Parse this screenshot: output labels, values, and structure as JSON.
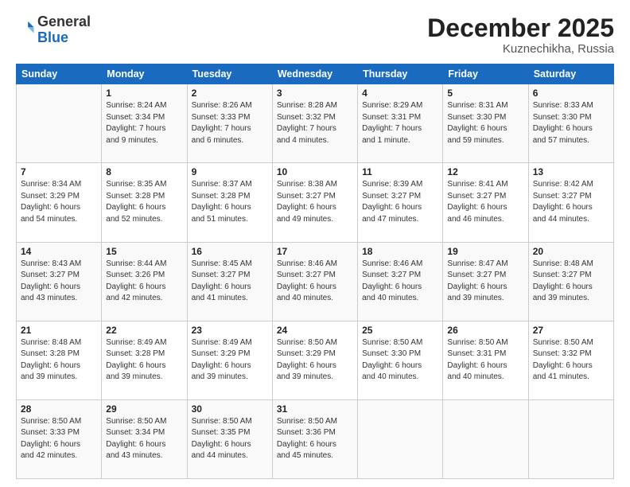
{
  "header": {
    "logo_line1": "General",
    "logo_line2": "Blue",
    "month": "December 2025",
    "location": "Kuznechikha, Russia"
  },
  "days_of_week": [
    "Sunday",
    "Monday",
    "Tuesday",
    "Wednesday",
    "Thursday",
    "Friday",
    "Saturday"
  ],
  "weeks": [
    [
      {
        "day": "",
        "info": ""
      },
      {
        "day": "1",
        "info": "Sunrise: 8:24 AM\nSunset: 3:34 PM\nDaylight: 7 hours\nand 9 minutes."
      },
      {
        "day": "2",
        "info": "Sunrise: 8:26 AM\nSunset: 3:33 PM\nDaylight: 7 hours\nand 6 minutes."
      },
      {
        "day": "3",
        "info": "Sunrise: 8:28 AM\nSunset: 3:32 PM\nDaylight: 7 hours\nand 4 minutes."
      },
      {
        "day": "4",
        "info": "Sunrise: 8:29 AM\nSunset: 3:31 PM\nDaylight: 7 hours\nand 1 minute."
      },
      {
        "day": "5",
        "info": "Sunrise: 8:31 AM\nSunset: 3:30 PM\nDaylight: 6 hours\nand 59 minutes."
      },
      {
        "day": "6",
        "info": "Sunrise: 8:33 AM\nSunset: 3:30 PM\nDaylight: 6 hours\nand 57 minutes."
      }
    ],
    [
      {
        "day": "7",
        "info": "Sunrise: 8:34 AM\nSunset: 3:29 PM\nDaylight: 6 hours\nand 54 minutes."
      },
      {
        "day": "8",
        "info": "Sunrise: 8:35 AM\nSunset: 3:28 PM\nDaylight: 6 hours\nand 52 minutes."
      },
      {
        "day": "9",
        "info": "Sunrise: 8:37 AM\nSunset: 3:28 PM\nDaylight: 6 hours\nand 51 minutes."
      },
      {
        "day": "10",
        "info": "Sunrise: 8:38 AM\nSunset: 3:27 PM\nDaylight: 6 hours\nand 49 minutes."
      },
      {
        "day": "11",
        "info": "Sunrise: 8:39 AM\nSunset: 3:27 PM\nDaylight: 6 hours\nand 47 minutes."
      },
      {
        "day": "12",
        "info": "Sunrise: 8:41 AM\nSunset: 3:27 PM\nDaylight: 6 hours\nand 46 minutes."
      },
      {
        "day": "13",
        "info": "Sunrise: 8:42 AM\nSunset: 3:27 PM\nDaylight: 6 hours\nand 44 minutes."
      }
    ],
    [
      {
        "day": "14",
        "info": "Sunrise: 8:43 AM\nSunset: 3:27 PM\nDaylight: 6 hours\nand 43 minutes."
      },
      {
        "day": "15",
        "info": "Sunrise: 8:44 AM\nSunset: 3:26 PM\nDaylight: 6 hours\nand 42 minutes."
      },
      {
        "day": "16",
        "info": "Sunrise: 8:45 AM\nSunset: 3:27 PM\nDaylight: 6 hours\nand 41 minutes."
      },
      {
        "day": "17",
        "info": "Sunrise: 8:46 AM\nSunset: 3:27 PM\nDaylight: 6 hours\nand 40 minutes."
      },
      {
        "day": "18",
        "info": "Sunrise: 8:46 AM\nSunset: 3:27 PM\nDaylight: 6 hours\nand 40 minutes."
      },
      {
        "day": "19",
        "info": "Sunrise: 8:47 AM\nSunset: 3:27 PM\nDaylight: 6 hours\nand 39 minutes."
      },
      {
        "day": "20",
        "info": "Sunrise: 8:48 AM\nSunset: 3:27 PM\nDaylight: 6 hours\nand 39 minutes."
      }
    ],
    [
      {
        "day": "21",
        "info": "Sunrise: 8:48 AM\nSunset: 3:28 PM\nDaylight: 6 hours\nand 39 minutes."
      },
      {
        "day": "22",
        "info": "Sunrise: 8:49 AM\nSunset: 3:28 PM\nDaylight: 6 hours\nand 39 minutes."
      },
      {
        "day": "23",
        "info": "Sunrise: 8:49 AM\nSunset: 3:29 PM\nDaylight: 6 hours\nand 39 minutes."
      },
      {
        "day": "24",
        "info": "Sunrise: 8:50 AM\nSunset: 3:29 PM\nDaylight: 6 hours\nand 39 minutes."
      },
      {
        "day": "25",
        "info": "Sunrise: 8:50 AM\nSunset: 3:30 PM\nDaylight: 6 hours\nand 40 minutes."
      },
      {
        "day": "26",
        "info": "Sunrise: 8:50 AM\nSunset: 3:31 PM\nDaylight: 6 hours\nand 40 minutes."
      },
      {
        "day": "27",
        "info": "Sunrise: 8:50 AM\nSunset: 3:32 PM\nDaylight: 6 hours\nand 41 minutes."
      }
    ],
    [
      {
        "day": "28",
        "info": "Sunrise: 8:50 AM\nSunset: 3:33 PM\nDaylight: 6 hours\nand 42 minutes."
      },
      {
        "day": "29",
        "info": "Sunrise: 8:50 AM\nSunset: 3:34 PM\nDaylight: 6 hours\nand 43 minutes."
      },
      {
        "day": "30",
        "info": "Sunrise: 8:50 AM\nSunset: 3:35 PM\nDaylight: 6 hours\nand 44 minutes."
      },
      {
        "day": "31",
        "info": "Sunrise: 8:50 AM\nSunset: 3:36 PM\nDaylight: 6 hours\nand 45 minutes."
      },
      {
        "day": "",
        "info": ""
      },
      {
        "day": "",
        "info": ""
      },
      {
        "day": "",
        "info": ""
      }
    ]
  ]
}
